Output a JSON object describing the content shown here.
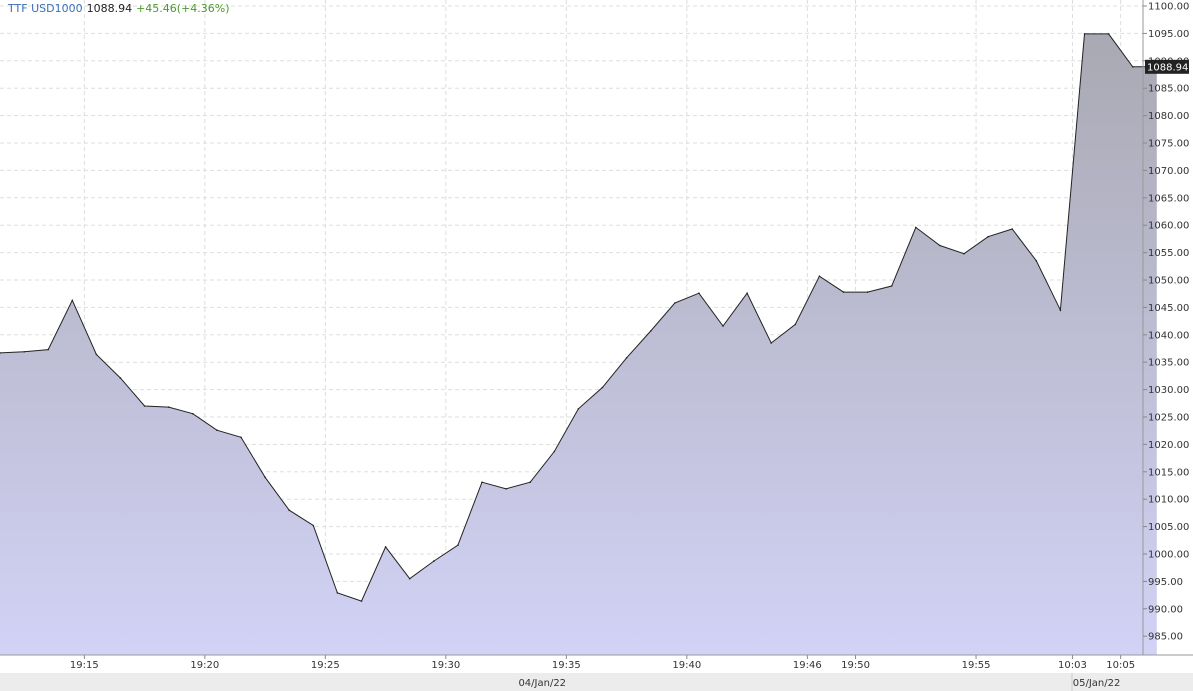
{
  "header": {
    "symbol": "TTF USD1000",
    "last": "1088.94",
    "change": "+45.46(+4.36%)"
  },
  "colors": {
    "line": "#222222",
    "fill_top": "#a9a9b3",
    "fill_bottom": "#d2d2f6",
    "grid": "#dddddd",
    "symbol": "#3b6fb6",
    "change": "#4a9a2a",
    "last_label_bg": "#222222"
  },
  "chart_data": {
    "type": "area",
    "title": "",
    "xlabel": "",
    "ylabel": "",
    "ylim": [
      981,
      1100
    ],
    "grid": true,
    "y_ticks": [
      "985.00",
      "990.00",
      "995.00",
      "1000.00",
      "1005.00",
      "1010.00",
      "1015.00",
      "1020.00",
      "1025.00",
      "1030.00",
      "1035.00",
      "1040.00",
      "1045.00",
      "1050.00",
      "1055.00",
      "1060.00",
      "1065.00",
      "1070.00",
      "1075.00",
      "1080.00",
      "1085.00",
      "1090.00",
      "1095.00",
      "1100.00"
    ],
    "x_ticks": [
      {
        "label": "19:15",
        "index": 3.5
      },
      {
        "label": "19:20",
        "index": 8.5
      },
      {
        "label": "19:25",
        "index": 13.5
      },
      {
        "label": "19:30",
        "index": 18.5
      },
      {
        "label": "19:35",
        "index": 23.5
      },
      {
        "label": "19:40",
        "index": 28.5
      },
      {
        "label": "19:46",
        "index": 33.5
      },
      {
        "label": "19:50",
        "index": 35.5
      },
      {
        "label": "19:55",
        "index": 40.5
      },
      {
        "label": "10:03",
        "index": 44.5
      },
      {
        "label": "10:05",
        "index": 46.5
      }
    ],
    "date_labels": [
      {
        "label": "04/Jan/22",
        "index": 22.5
      },
      {
        "label": "05/Jan/22",
        "index": 45.5
      }
    ],
    "series": [
      {
        "values": [
          1036.7,
          1036.9,
          1037.3,
          1046.3,
          1036.4,
          1032.1,
          1027.0,
          1026.8,
          1025.6,
          1022.6,
          1021.3,
          1014.0,
          1008.0,
          1005.2,
          992.9,
          991.4,
          1001.3,
          995.5,
          998.7,
          1001.6,
          1013.1,
          1011.9,
          1013.1,
          1018.7,
          1026.5,
          1030.4,
          1035.8,
          1040.7,
          1045.8,
          1047.6,
          1041.6,
          1047.6,
          1038.5,
          1041.9,
          1050.7,
          1047.8,
          1047.8,
          1048.9,
          1059.6,
          1056.3,
          1054.8,
          1057.9,
          1059.3,
          1053.5,
          1044.5,
          1094.9,
          1094.9,
          1088.9,
          1088.9
        ]
      }
    ],
    "last_value": "1088.94"
  }
}
